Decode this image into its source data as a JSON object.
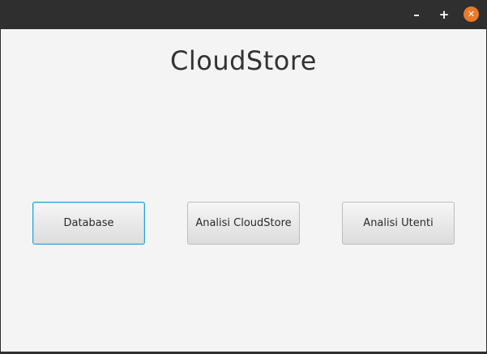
{
  "titlebar": {
    "minimize_glyph": "–",
    "maximize_glyph": "+",
    "close_glyph": "✕",
    "close_color": "#e9792b"
  },
  "app": {
    "title": "CloudStore"
  },
  "buttons": [
    {
      "label": "Database",
      "focused": true
    },
    {
      "label": "Analisi CloudStore",
      "focused": false
    },
    {
      "label": "Analisi Utenti",
      "focused": false
    }
  ],
  "colors": {
    "focus_border": "#2aa2d6",
    "window_bg": "#f4f4f4",
    "titlebar_bg": "#2f2f2f"
  }
}
